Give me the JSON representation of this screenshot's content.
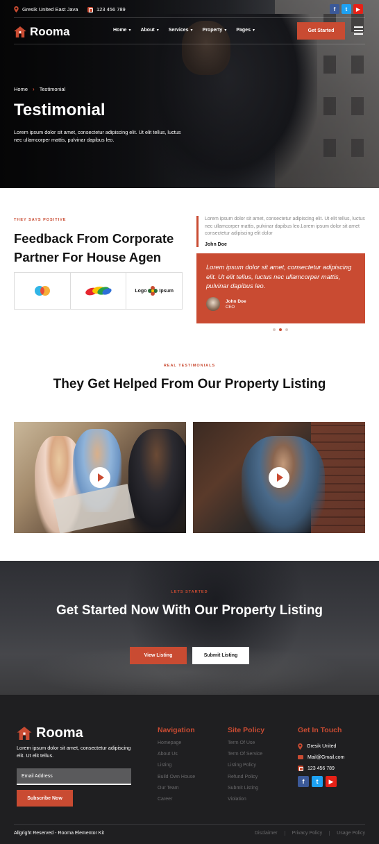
{
  "topbar": {
    "location": "Gresik United East Java",
    "phone": "123 456 789",
    "socials": [
      "facebook-icon",
      "twitter-icon",
      "youtube-icon"
    ]
  },
  "nav": {
    "brand": "Rooma",
    "items": [
      {
        "label": "Home"
      },
      {
        "label": "About"
      },
      {
        "label": "Services"
      },
      {
        "label": "Property"
      },
      {
        "label": "Pages"
      }
    ],
    "cta": "Get Started"
  },
  "hero": {
    "breadcrumb": [
      "Home",
      "Testimonial"
    ],
    "title": "Testimonial",
    "description": "Lorem ipsum dolor sit amet, consectetur adipiscing elit. Ut elit tellus, luctus nec ullamcorper mattis, pulvinar dapibus leo."
  },
  "feedback": {
    "eyebrow": "THEY SAYS POSITIVE",
    "title": "Feedback From Corporate Partner For House Agen",
    "logos": {
      "third_label_a": "Logo",
      "third_label_b": "Ipsum"
    },
    "quote_small": {
      "text": "Lorem ipsum dolor sit amet, consectetur adipiscing elit. Ut elit tellus, luctus nec ullamcorper mattis, pulvinar dapibus leo.Lorem ipsum dolor sit amet consectetur adipiscing elit dolor",
      "name": "John Doe"
    },
    "quote_card": {
      "text": "Lorem ipsum dolor sit amet, consectetur adipiscing elit. Ut elit tellus, luctus nec ullamcorper mattis, pulvinar dapibus leo.",
      "name": "John Doe",
      "role": "CEO"
    },
    "slider_active": 1
  },
  "testimonials": {
    "eyebrow": "REAL TESTIMONIALS",
    "title": "They Get Helped From Our Property Listing"
  },
  "cta": {
    "eyebrow": "LETS STARTED",
    "title": "Get Started Now With Our Property Listing",
    "primary": "View Listing",
    "secondary": "Submit Listing"
  },
  "footer": {
    "brand": "Rooma",
    "description": "Lorem ipsum dolor sit amet, consectetur adipiscing elit. Ut elit tellus.",
    "email_placeholder": "Email Address",
    "subscribe": "Subscribe Now",
    "navigation": {
      "title": "Navigation",
      "items": [
        "Homepage",
        "About Us",
        "Listing",
        "Build Own House",
        "Our Team",
        "Career"
      ]
    },
    "policy": {
      "title": "Site Policy",
      "items": [
        "Term Of Use",
        "Term Of Service",
        "Listing Policy",
        "Refund Policy",
        "Submit Listing",
        "Violation"
      ]
    },
    "contact": {
      "title": "Get In Touch",
      "location": "Gresik United",
      "email": "Mail@Gmail.com",
      "phone": "123 456 789"
    },
    "copyright": "Allgright Reserved - Rooma Elementor Kit",
    "legal": [
      "Disclaimer",
      "Privacy Policy",
      "Usage Policy"
    ]
  },
  "colors": {
    "accent": "#c94b32",
    "footer_bg": "#1f1f21"
  }
}
